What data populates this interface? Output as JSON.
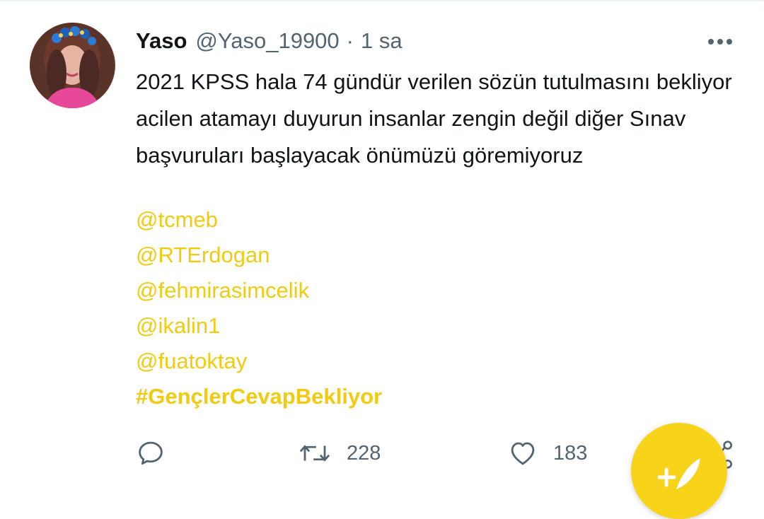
{
  "tweet": {
    "author_name": "Yaso",
    "author_handle": "@Yaso_19900",
    "separator": "·",
    "time": "1 sa",
    "text": "2021 KPSS hala 74 gündür verilen sözün tutulmasını bekliyor acilen atamayı duyurun insanlar zengin değil diğer Sınav başvuruları başlayacak önümüzü göremiyoruz",
    "mentions": [
      "@tcmeb",
      "@RTErdogan",
      "@fehmirasimcelik",
      "@ikalin1",
      "@fuatoktay"
    ],
    "hashtag": "#GençlerCevapBekliyor"
  },
  "actions": {
    "reply_icon": "reply-bubble-icon",
    "retweet_icon": "retweet-icon",
    "retweet_count": "228",
    "like_icon": "heart-icon",
    "like_count": "183",
    "share_icon": "share-icon"
  },
  "fab": {
    "icon": "compose-tweet-icon"
  },
  "colors": {
    "accent": "#f2cb10",
    "fab_background": "#f7d31a",
    "secondary_text": "#536471",
    "primary_text": "#0f1419"
  }
}
